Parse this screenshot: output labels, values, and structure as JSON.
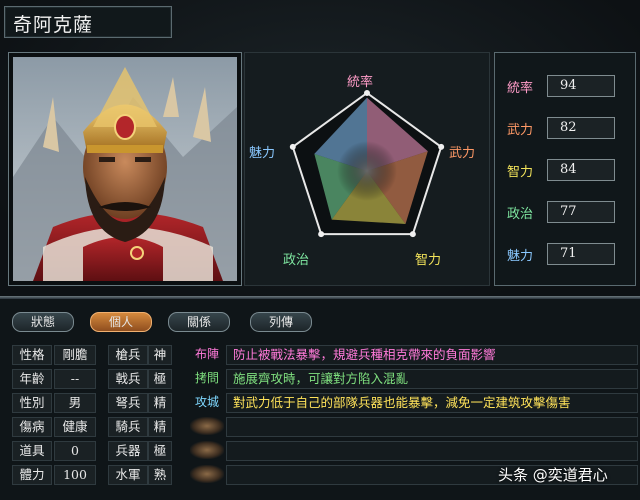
{
  "general": {
    "name": "奇阿克薩"
  },
  "radar": {
    "labels": [
      "統率",
      "武力",
      "智力",
      "政治",
      "魅力"
    ],
    "values": [
      94,
      82,
      84,
      77,
      71
    ],
    "max": 100
  },
  "stats": [
    {
      "label": "統率",
      "value": "94",
      "color": "#ff9cc8"
    },
    {
      "label": "武力",
      "value": "82",
      "color": "#ff9966"
    },
    {
      "label": "智力",
      "value": "84",
      "color": "#f2e35a"
    },
    {
      "label": "政治",
      "value": "77",
      "color": "#7ee6a0"
    },
    {
      "label": "魅力",
      "value": "71",
      "color": "#8ac8ff"
    }
  ],
  "radar_label_colors": [
    "#ff9cc8",
    "#ff9966",
    "#f2e35a",
    "#7ee6a0",
    "#8ac8ff"
  ],
  "tabs": [
    {
      "label": "狀態",
      "active": false
    },
    {
      "label": "個人",
      "active": true
    },
    {
      "label": "關係",
      "active": false
    },
    {
      "label": "列傳",
      "active": false
    }
  ],
  "personal": [
    {
      "label": "性格",
      "value": "剛膽"
    },
    {
      "label": "年齡",
      "value": "--"
    },
    {
      "label": "性別",
      "value": "男"
    },
    {
      "label": "傷病",
      "value": "健康"
    },
    {
      "label": "道具",
      "value": "0"
    },
    {
      "label": "體力",
      "value": "100"
    }
  ],
  "troops": [
    {
      "label": "槍兵",
      "value": "神"
    },
    {
      "label": "戟兵",
      "value": "極"
    },
    {
      "label": "弩兵",
      "value": "精"
    },
    {
      "label": "騎兵",
      "value": "精"
    },
    {
      "label": "兵器",
      "value": "極"
    },
    {
      "label": "水軍",
      "value": "熟"
    }
  ],
  "skills": [
    {
      "name": "布陣",
      "desc": "防止被戰法暴擊，規避兵種相克帶來的負面影響",
      "name_color": "#ff7ad9",
      "desc_color": "#ff7ad9"
    },
    {
      "name": "拷問",
      "desc": "施展齊攻時，可讓對方陷入混亂",
      "name_color": "#7fe07f",
      "desc_color": "#7fe07f"
    },
    {
      "name": "攻城",
      "desc": "對武力低于自己的部隊兵器也能暴擊，減免一定建筑攻擊傷害",
      "name_color": "#7fd8ff",
      "desc_color": "#ffe35a"
    },
    {
      "name": "",
      "desc": "",
      "name_color": "#ffffff",
      "desc_color": "#ffffff"
    },
    {
      "name": "",
      "desc": "",
      "name_color": "#ffffff",
      "desc_color": "#ffffff"
    },
    {
      "name": "",
      "desc": "",
      "name_color": "#ffffff",
      "desc_color": "#ffffff"
    }
  ],
  "watermark": "头条 @奕道君心"
}
